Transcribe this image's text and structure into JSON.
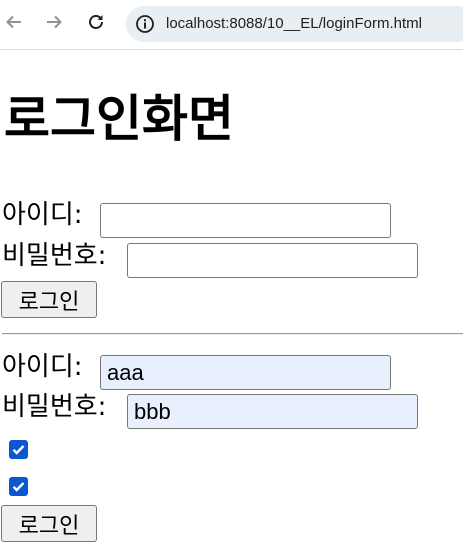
{
  "browser": {
    "url": "localhost:8088/10__EL/loginForm.html",
    "back_icon": "arrow-left-icon",
    "forward_icon": "arrow-right-icon",
    "reload_icon": "reload-icon",
    "site_info_icon": "site-info-icon"
  },
  "page": {
    "title": "로그인화면"
  },
  "form1": {
    "id_label": "아이디:",
    "id_value": "",
    "pw_label": "비밀번호:",
    "pw_value": "",
    "submit_label": "로그인"
  },
  "form2": {
    "id_label": "아이디:",
    "id_value": "aaa",
    "pw_label": "비밀번호:",
    "pw_value": "bbb",
    "checkbox1_checked": true,
    "checkbox2_checked": true,
    "submit_label": "로그인"
  },
  "colors": {
    "accent": "#0b57d0",
    "autofill_bg": "#e8f0fe",
    "omnibox_bg": "#e9eef3"
  }
}
